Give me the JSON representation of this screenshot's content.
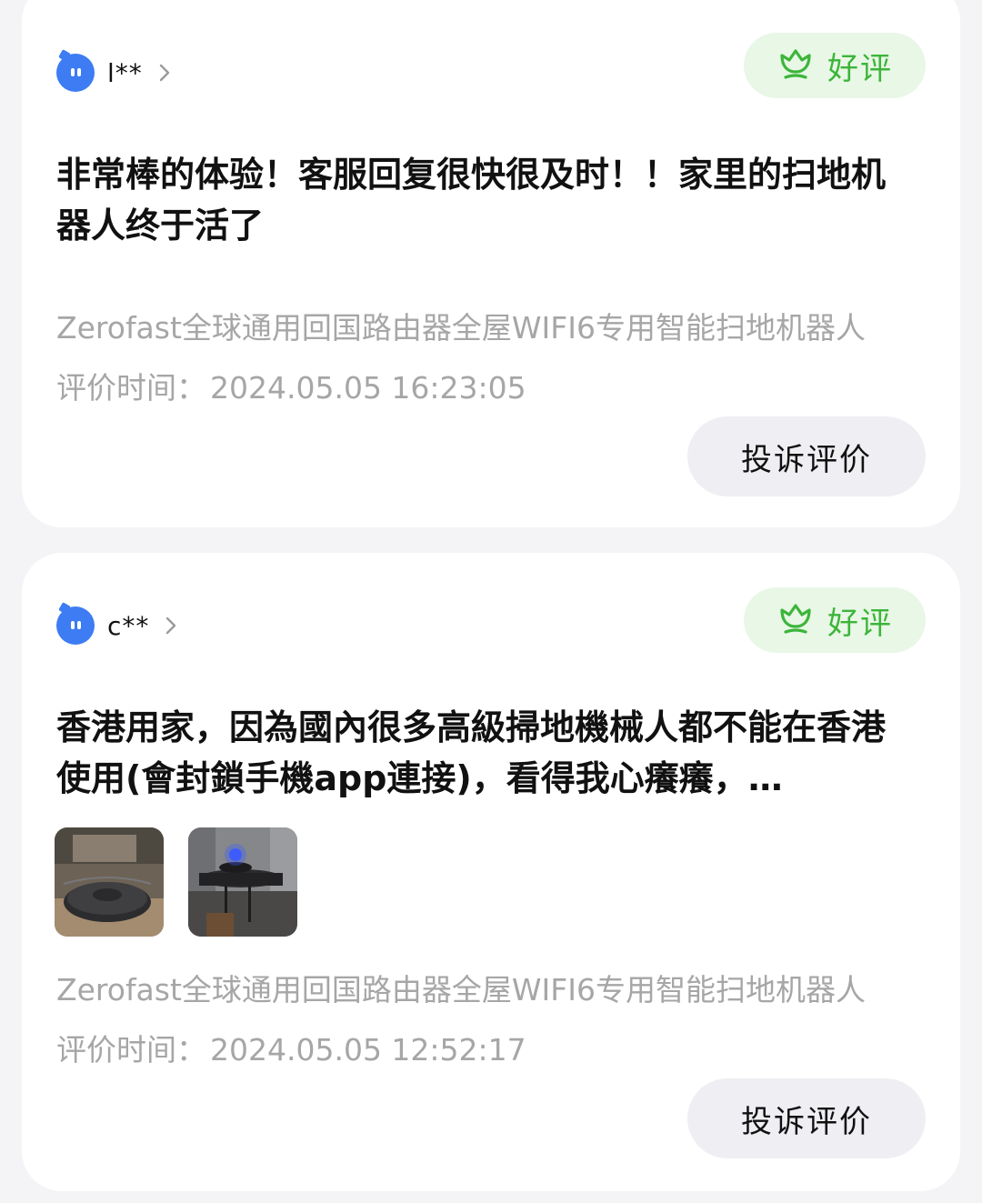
{
  "reviews": [
    {
      "username": "l**",
      "badge": "好评",
      "text": "非常棒的体验！客服回复很快很及时！！家里的扫地机器人终于活了",
      "images": [],
      "product": "Zerofast全球通用回国路由器全屋WIFI6专用智能扫地机器人",
      "time_label": "评价时间：",
      "time_value": "2024.05.05 16:23:05",
      "complain_label": "投诉评价"
    },
    {
      "username": "c**",
      "badge": "好评",
      "text": "香港用家，因為國內很多高級掃地機械人都不能在香港使用(會封鎖手機app連接)，看得我心癢癢，…",
      "images": [
        "robot-vacuum-on-floor-photo",
        "robot-vacuum-blue-light-photo"
      ],
      "product": "Zerofast全球通用回国路由器全屋WIFI6专用智能扫地机器人",
      "time_label": "评价时间：",
      "time_value": "2024.05.05 12:52:17",
      "complain_label": "投诉评价"
    }
  ],
  "colors": {
    "badge_green": "#3cb53a",
    "badge_bg": "#e8f7e6",
    "avatar_blue": "#3d7cf3",
    "muted_text": "#a6a6a6"
  },
  "icons": {
    "badge": "tulip-flower-icon",
    "avatar": "blue-mascot-avatar",
    "chevron": "chevron-right-icon"
  }
}
